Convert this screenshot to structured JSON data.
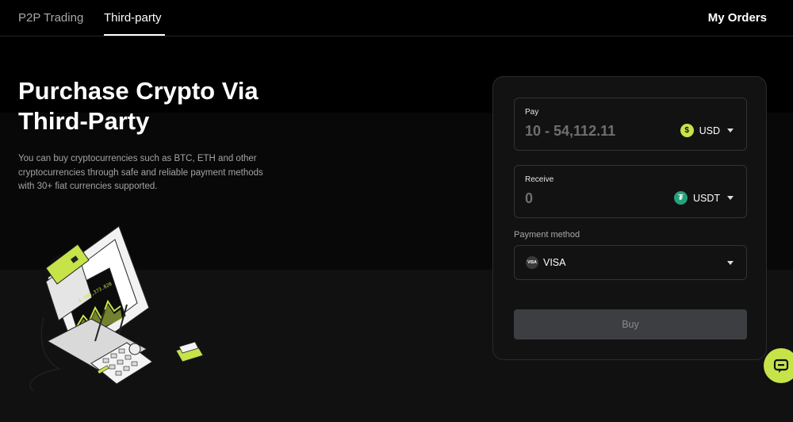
{
  "nav": {
    "tabs": [
      {
        "label": "P2P Trading",
        "active": false
      },
      {
        "label": "Third-party",
        "active": true
      }
    ],
    "my_orders": "My Orders"
  },
  "hero": {
    "title_line1": "Purchase Crypto Via",
    "title_line2": "Third-Party",
    "description": "You can buy cryptocurrencies such as BTC, ETH and other cryptocurrencies through safe and reliable payment methods with 30+ fiat currencies supported."
  },
  "illustration": {
    "balance_text": "$ 100,373.820",
    "card_text": "VIRTUAL"
  },
  "form": {
    "pay": {
      "label": "Pay",
      "placeholder": "10 - 54,112.11",
      "currency": "USD",
      "icon": "dollar-coin-icon"
    },
    "receive": {
      "label": "Receive",
      "value": "0",
      "currency": "USDT",
      "icon": "tether-icon"
    },
    "payment_method": {
      "label": "Payment method",
      "selected": "VISA",
      "badge": "VISA"
    },
    "buy_label": "Buy"
  },
  "colors": {
    "accent": "#c6e34a",
    "tether": "#26a17b",
    "button_disabled": "#3d3e42"
  }
}
